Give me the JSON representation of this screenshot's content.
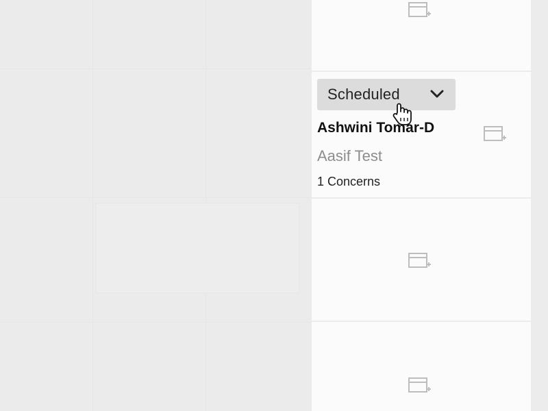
{
  "appointment": {
    "status": "Scheduled",
    "name": "Ashwini Tomar-D",
    "subtitle": "Aasif Test",
    "concerns": "1 Concerns"
  },
  "icons": {
    "dropdown": "chevron-down-icon",
    "slot_add": "calendar-add-icon",
    "cursor": "hand-pointer-cursor-icon"
  },
  "colors": {
    "dropdown_bg": "#dcdcdc",
    "subtitle_text": "#8d8d8d",
    "column_bg": "#fbfbfb",
    "page_bg": "#ececec"
  }
}
